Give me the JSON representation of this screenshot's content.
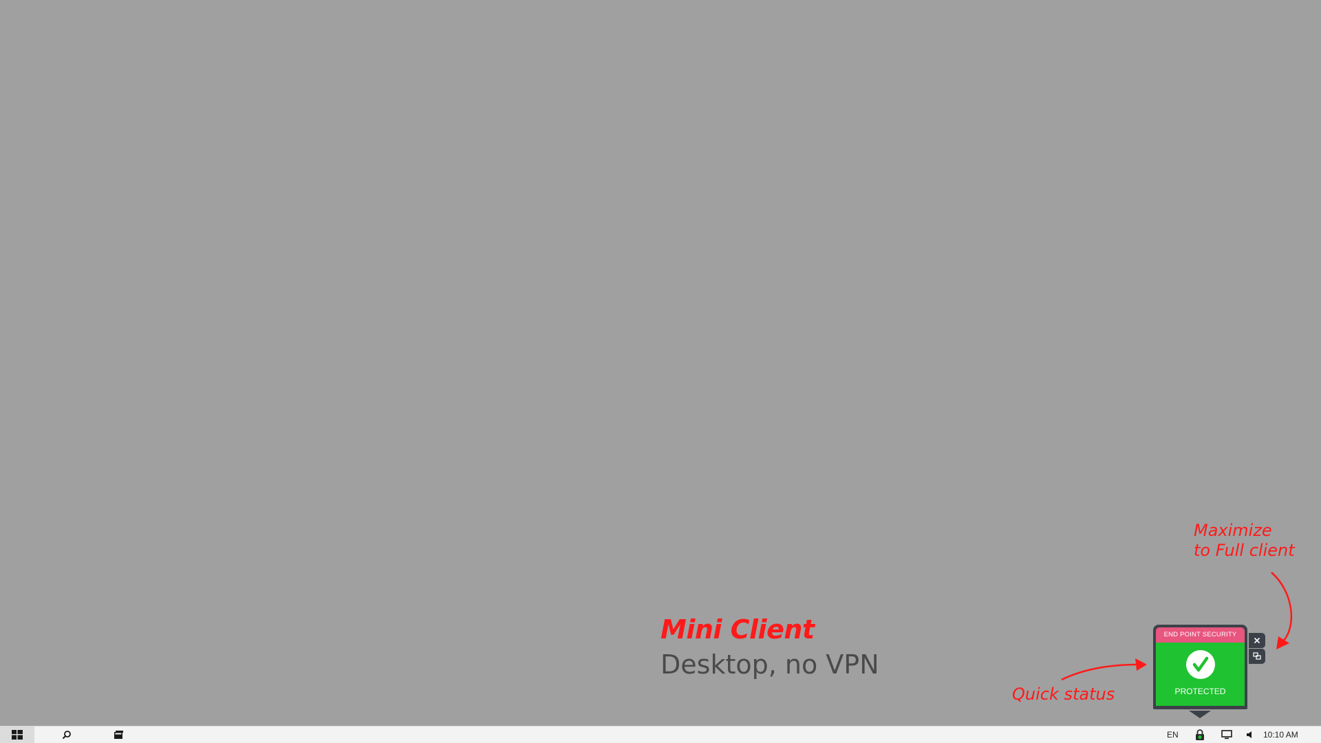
{
  "annotations": {
    "title": "Mini Client",
    "subtitle": "Desktop, no VPN",
    "quick_status_label": "Quick status",
    "maximize_label_line1": "Maximize",
    "maximize_label_line2": "to Full client"
  },
  "mini_client": {
    "header": "END POINT SECURITY",
    "status": "PROTECTED",
    "status_icon": "checkmark-icon",
    "close_icon": "close-icon",
    "maximize_icon": "maximize-icon",
    "colors": {
      "header": "#e8557f",
      "body": "#1fc230",
      "frame": "#3c4149"
    }
  },
  "taskbar": {
    "start_icon": "windows-start-icon",
    "search_icon": "search-icon",
    "task_view_icon": "task-view-icon",
    "tray": {
      "language": "EN",
      "security_icon": "lock-icon",
      "display_icon": "monitor-icon",
      "volume_icon": "volume-icon",
      "clock": "10:10 AM"
    }
  },
  "colors": {
    "desktop": "#a0a0a0",
    "annotation": "#ff1a1a"
  }
}
